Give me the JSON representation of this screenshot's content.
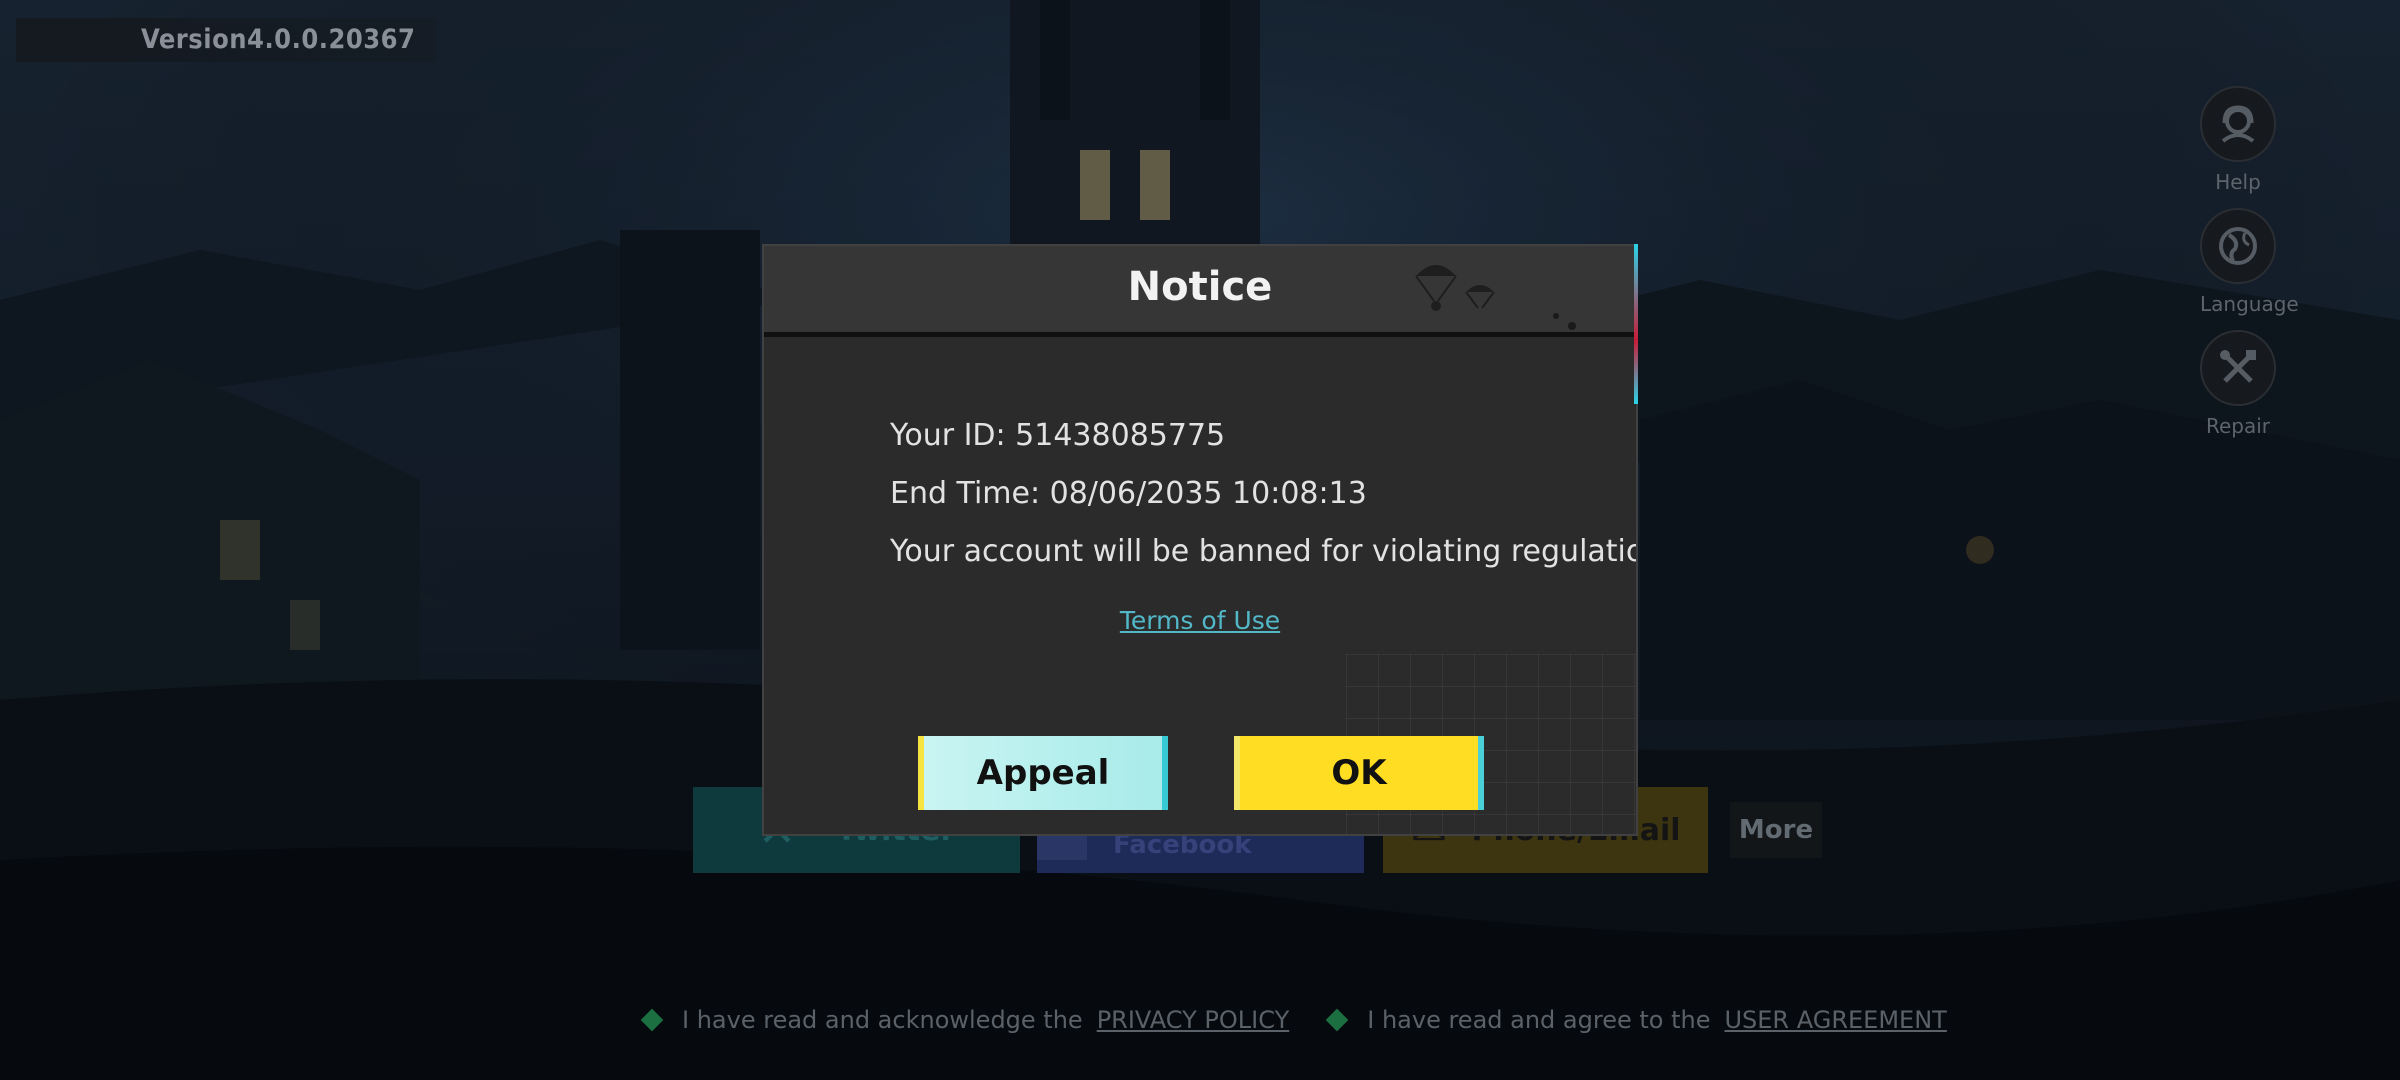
{
  "version_label": "Version4.0.0.20367",
  "side_menu": {
    "help_label": "Help",
    "language_label": "Language",
    "repair_label": "Repair"
  },
  "login": {
    "twitter_label": "Twitter",
    "facebook_label": "Login with Facebook",
    "phone_label": "Phone/Email",
    "more_label": "More"
  },
  "footer": {
    "privacy_text": "I have read and acknowledge the",
    "privacy_link": "PRIVACY POLICY",
    "agreement_text": "I have read and agree to the",
    "agreement_link": "USER AGREEMENT"
  },
  "notice": {
    "title": "Notice",
    "id_line": "Your ID: 51438085775",
    "end_time_line": "End Time: 08/06/2035 10:08:13",
    "message": "Your account will be banned for violating regulations.",
    "terms_link": "Terms of Use",
    "appeal_label": "Appeal",
    "ok_label": "OK"
  },
  "colors": {
    "ok_button": "#ffdd22",
    "appeal_button": "#c9f4f2",
    "terms_link": "#52b8c8",
    "modal_bg": "#2b2b2b"
  }
}
